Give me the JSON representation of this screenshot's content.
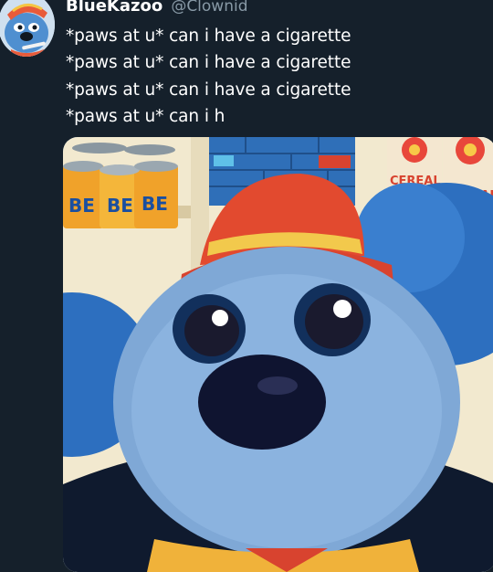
{
  "tweet": {
    "author": {
      "display_name": "BlueKazoo",
      "handle": "@Clownid",
      "avatar_icon": "clown-dog-avatar-icon"
    },
    "lines": [
      "*paws at u* can i have a cigarette",
      "*paws at u* can i have a cigarette",
      "*paws at u* can i have a cigarette",
      "*paws at u* can i h"
    ],
    "media": {
      "description_icon": "clown-dog-looking-up-illustration",
      "shelf_can_text": "BE",
      "cereal_box_text": "CEREAL"
    }
  },
  "colors": {
    "background": "#15202b",
    "name": "#ffffff",
    "handle": "#8899a6",
    "text": "#ffffff"
  }
}
